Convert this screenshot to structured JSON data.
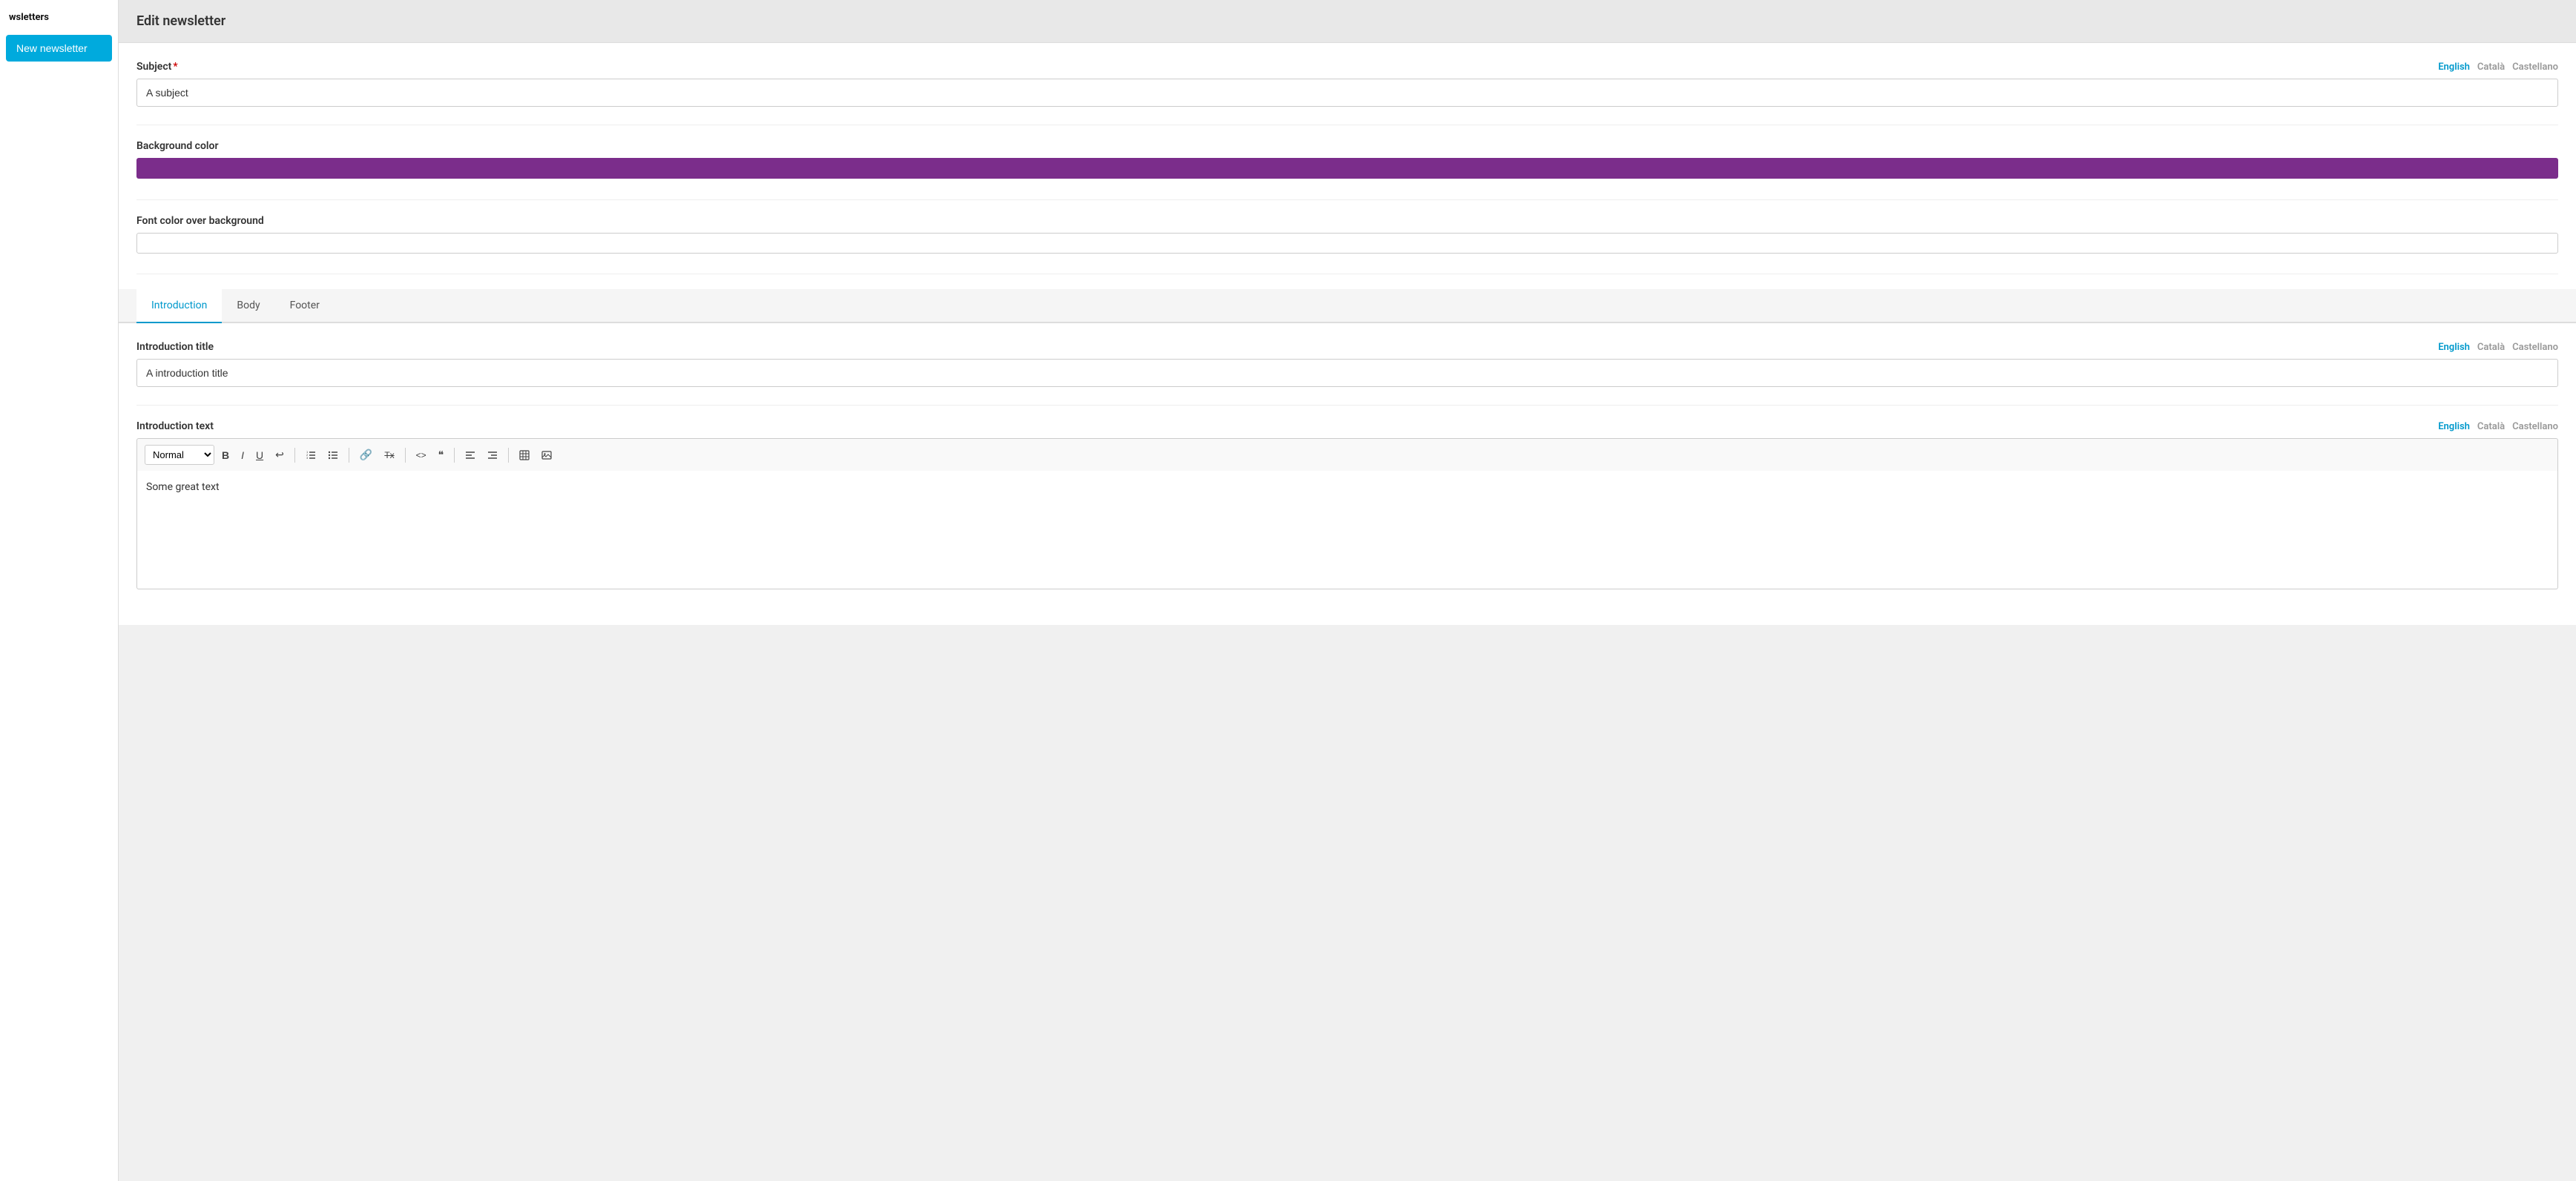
{
  "sidebar": {
    "title": "wsletters",
    "new_button_label": "New newsletter"
  },
  "page": {
    "header": "Edit newsletter"
  },
  "subject": {
    "label": "Subject",
    "required": true,
    "value": "A subject",
    "languages": {
      "active": "English",
      "options": [
        "English",
        "Català",
        "Castellano"
      ]
    }
  },
  "background_color": {
    "label": "Background color",
    "color": "#7b2d8b"
  },
  "font_color": {
    "label": "Font color over background",
    "color": "#ffffff"
  },
  "tabs": [
    {
      "id": "introduction",
      "label": "Introduction",
      "active": true
    },
    {
      "id": "body",
      "label": "Body",
      "active": false
    },
    {
      "id": "footer",
      "label": "Footer",
      "active": false
    }
  ],
  "introduction_title": {
    "label": "Introduction title",
    "value": "A introduction title",
    "languages": {
      "active": "English",
      "options": [
        "English",
        "Català",
        "Castellano"
      ]
    }
  },
  "introduction_text": {
    "label": "Introduction text",
    "toolbar": {
      "format_select": "Normal",
      "bold": "B",
      "italic": "I",
      "underline": "U",
      "strikethrough": "↩",
      "ordered_list": "≡",
      "unordered_list": "≡",
      "link": "🔗",
      "clear_format": "T̶",
      "code": "<>",
      "quote": "❝",
      "align_left": "⇤",
      "align_right": "⇥",
      "table": "⊞",
      "image": "🖼"
    },
    "content": "Some great text",
    "languages": {
      "active": "English",
      "options": [
        "English",
        "Català",
        "Castellano"
      ]
    }
  }
}
